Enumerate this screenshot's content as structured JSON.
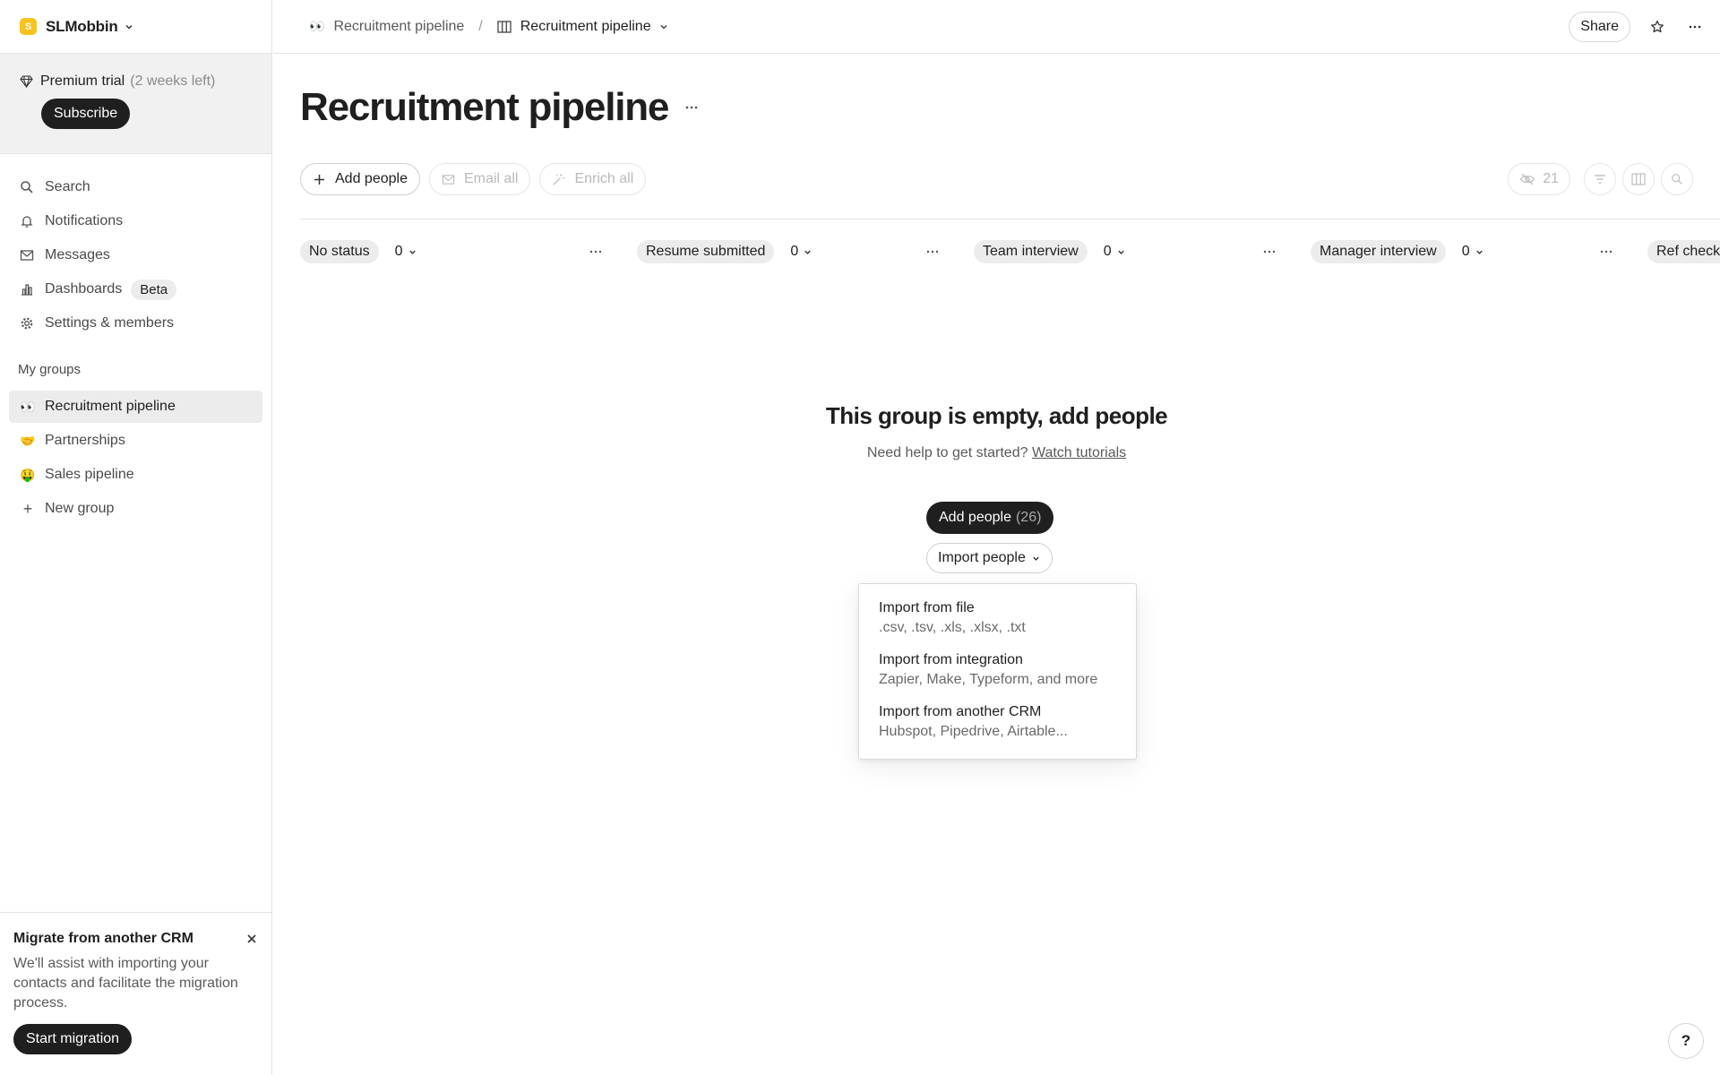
{
  "workspace": {
    "logo_letter": "S",
    "name": "SLMobbin"
  },
  "trial": {
    "label": "Premium trial",
    "remaining": "(2 weeks left)",
    "subscribe_label": "Subscribe"
  },
  "nav": {
    "search": "Search",
    "notifications": "Notifications",
    "messages": "Messages",
    "dashboards": "Dashboards",
    "dashboards_badge": "Beta",
    "settings": "Settings & members"
  },
  "groups": {
    "section_label": "My groups",
    "items": [
      {
        "emoji": "👀",
        "label": "Recruitment pipeline"
      },
      {
        "emoji": "🤝",
        "label": "Partnerships"
      },
      {
        "emoji": "🤑",
        "label": "Sales pipeline"
      }
    ],
    "new_group_label": "New group"
  },
  "migrate": {
    "title": "Migrate from another CRM",
    "description": "We'll assist with importing your contacts and facilitate the migration process.",
    "button_label": "Start migration"
  },
  "breadcrumb": {
    "group_emoji": "👀",
    "group": "Recruitment pipeline",
    "separator": "/",
    "view": "Recruitment pipeline"
  },
  "top_actions": {
    "share_label": "Share"
  },
  "page": {
    "title": "Recruitment pipeline"
  },
  "toolbar": {
    "add_people": "Add people",
    "email_all": "Email all",
    "enrich_all": "Enrich all",
    "hidden_count": "21"
  },
  "columns": [
    {
      "label": "No status",
      "count": "0"
    },
    {
      "label": "Resume submitted",
      "count": "0"
    },
    {
      "label": "Team interview",
      "count": "0"
    },
    {
      "label": "Manager interview",
      "count": "0"
    },
    {
      "label": "Ref check",
      "count": ""
    }
  ],
  "empty_state": {
    "title": "This group is empty, add people",
    "help_text": "Need help to get started?",
    "help_link": "Watch tutorials",
    "add_people_label": "Add people",
    "add_people_count": "(26)",
    "import_label": "Import people"
  },
  "import_menu": [
    {
      "title": "Import from file",
      "subtitle": ".csv, .tsv, .xls, .xlsx, .txt"
    },
    {
      "title": "Import from integration",
      "subtitle": "Zapier, Make, Typeform, and more"
    },
    {
      "title": "Import from another CRM",
      "subtitle": "Hubspot, Pipedrive, Airtable..."
    }
  ],
  "help_button_label": "?"
}
